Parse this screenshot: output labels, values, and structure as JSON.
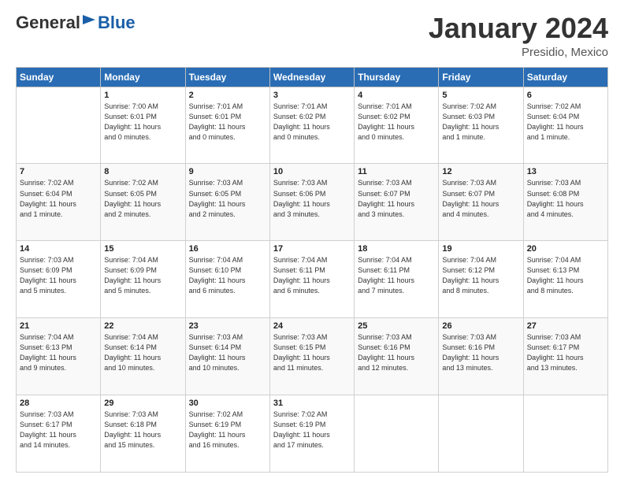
{
  "logo": {
    "general": "General",
    "blue": "Blue"
  },
  "title": "January 2024",
  "location": "Presidio, Mexico",
  "days_header": [
    "Sunday",
    "Monday",
    "Tuesday",
    "Wednesday",
    "Thursday",
    "Friday",
    "Saturday"
  ],
  "weeks": [
    [
      {
        "day": "",
        "info": ""
      },
      {
        "day": "1",
        "info": "Sunrise: 7:00 AM\nSunset: 6:01 PM\nDaylight: 11 hours\nand 0 minutes."
      },
      {
        "day": "2",
        "info": "Sunrise: 7:01 AM\nSunset: 6:01 PM\nDaylight: 11 hours\nand 0 minutes."
      },
      {
        "day": "3",
        "info": "Sunrise: 7:01 AM\nSunset: 6:02 PM\nDaylight: 11 hours\nand 0 minutes."
      },
      {
        "day": "4",
        "info": "Sunrise: 7:01 AM\nSunset: 6:02 PM\nDaylight: 11 hours\nand 0 minutes."
      },
      {
        "day": "5",
        "info": "Sunrise: 7:02 AM\nSunset: 6:03 PM\nDaylight: 11 hours\nand 1 minute."
      },
      {
        "day": "6",
        "info": "Sunrise: 7:02 AM\nSunset: 6:04 PM\nDaylight: 11 hours\nand 1 minute."
      }
    ],
    [
      {
        "day": "7",
        "info": "Sunrise: 7:02 AM\nSunset: 6:04 PM\nDaylight: 11 hours\nand 1 minute."
      },
      {
        "day": "8",
        "info": "Sunrise: 7:02 AM\nSunset: 6:05 PM\nDaylight: 11 hours\nand 2 minutes."
      },
      {
        "day": "9",
        "info": "Sunrise: 7:03 AM\nSunset: 6:05 PM\nDaylight: 11 hours\nand 2 minutes."
      },
      {
        "day": "10",
        "info": "Sunrise: 7:03 AM\nSunset: 6:06 PM\nDaylight: 11 hours\nand 3 minutes."
      },
      {
        "day": "11",
        "info": "Sunrise: 7:03 AM\nSunset: 6:07 PM\nDaylight: 11 hours\nand 3 minutes."
      },
      {
        "day": "12",
        "info": "Sunrise: 7:03 AM\nSunset: 6:07 PM\nDaylight: 11 hours\nand 4 minutes."
      },
      {
        "day": "13",
        "info": "Sunrise: 7:03 AM\nSunset: 6:08 PM\nDaylight: 11 hours\nand 4 minutes."
      }
    ],
    [
      {
        "day": "14",
        "info": "Sunrise: 7:03 AM\nSunset: 6:09 PM\nDaylight: 11 hours\nand 5 minutes."
      },
      {
        "day": "15",
        "info": "Sunrise: 7:04 AM\nSunset: 6:09 PM\nDaylight: 11 hours\nand 5 minutes."
      },
      {
        "day": "16",
        "info": "Sunrise: 7:04 AM\nSunset: 6:10 PM\nDaylight: 11 hours\nand 6 minutes."
      },
      {
        "day": "17",
        "info": "Sunrise: 7:04 AM\nSunset: 6:11 PM\nDaylight: 11 hours\nand 6 minutes."
      },
      {
        "day": "18",
        "info": "Sunrise: 7:04 AM\nSunset: 6:11 PM\nDaylight: 11 hours\nand 7 minutes."
      },
      {
        "day": "19",
        "info": "Sunrise: 7:04 AM\nSunset: 6:12 PM\nDaylight: 11 hours\nand 8 minutes."
      },
      {
        "day": "20",
        "info": "Sunrise: 7:04 AM\nSunset: 6:13 PM\nDaylight: 11 hours\nand 8 minutes."
      }
    ],
    [
      {
        "day": "21",
        "info": "Sunrise: 7:04 AM\nSunset: 6:13 PM\nDaylight: 11 hours\nand 9 minutes."
      },
      {
        "day": "22",
        "info": "Sunrise: 7:04 AM\nSunset: 6:14 PM\nDaylight: 11 hours\nand 10 minutes."
      },
      {
        "day": "23",
        "info": "Sunrise: 7:03 AM\nSunset: 6:14 PM\nDaylight: 11 hours\nand 10 minutes."
      },
      {
        "day": "24",
        "info": "Sunrise: 7:03 AM\nSunset: 6:15 PM\nDaylight: 11 hours\nand 11 minutes."
      },
      {
        "day": "25",
        "info": "Sunrise: 7:03 AM\nSunset: 6:16 PM\nDaylight: 11 hours\nand 12 minutes."
      },
      {
        "day": "26",
        "info": "Sunrise: 7:03 AM\nSunset: 6:16 PM\nDaylight: 11 hours\nand 13 minutes."
      },
      {
        "day": "27",
        "info": "Sunrise: 7:03 AM\nSunset: 6:17 PM\nDaylight: 11 hours\nand 13 minutes."
      }
    ],
    [
      {
        "day": "28",
        "info": "Sunrise: 7:03 AM\nSunset: 6:17 PM\nDaylight: 11 hours\nand 14 minutes."
      },
      {
        "day": "29",
        "info": "Sunrise: 7:03 AM\nSunset: 6:18 PM\nDaylight: 11 hours\nand 15 minutes."
      },
      {
        "day": "30",
        "info": "Sunrise: 7:02 AM\nSunset: 6:19 PM\nDaylight: 11 hours\nand 16 minutes."
      },
      {
        "day": "31",
        "info": "Sunrise: 7:02 AM\nSunset: 6:19 PM\nDaylight: 11 hours\nand 17 minutes."
      },
      {
        "day": "",
        "info": ""
      },
      {
        "day": "",
        "info": ""
      },
      {
        "day": "",
        "info": ""
      }
    ]
  ]
}
